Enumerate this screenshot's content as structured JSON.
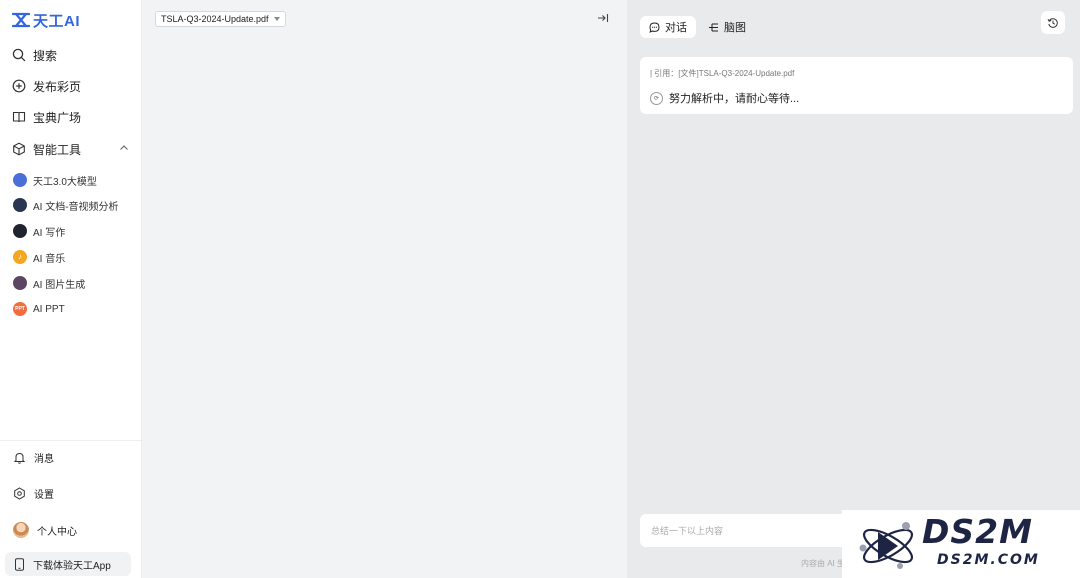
{
  "brand": {
    "name": "天工AI",
    "color": "#3465e0",
    "icon": "tiangong-logo-icon"
  },
  "sidebar": {
    "nav": [
      {
        "label": "搜索",
        "icon": "search-icon"
      },
      {
        "label": "发布彩页",
        "icon": "plus-circle-icon"
      },
      {
        "label": "宝典广场",
        "icon": "book-icon"
      },
      {
        "label": "智能工具",
        "icon": "cube-icon",
        "expanded": true
      }
    ],
    "tools": [
      {
        "label": "天工3.0大模型",
        "icon": "tiangong-model-icon",
        "color": "#4a6fd8"
      },
      {
        "label": "AI 文档-音视频分析",
        "icon": "doc-analysis-icon",
        "color": "#2a3552"
      },
      {
        "label": "AI 写作",
        "icon": "writing-icon",
        "color": "#1f2430"
      },
      {
        "label": "AI 音乐",
        "icon": "music-icon",
        "color": "#f5a623"
      },
      {
        "label": "AI 图片生成",
        "icon": "image-gen-icon",
        "color": "#5a4660"
      },
      {
        "label": "AI PPT",
        "icon": "ppt-icon",
        "color": "#f26d3d"
      }
    ],
    "bottom": [
      {
        "label": "消息",
        "icon": "bell-icon"
      },
      {
        "label": "设置",
        "icon": "settings-icon"
      },
      {
        "label": "个人中心",
        "icon": "avatar"
      }
    ],
    "download": {
      "label": "下载体验天工App",
      "icon": "phone-icon"
    }
  },
  "document": {
    "file_name": "TSLA-Q3-2024-Update.pdf"
  },
  "chat": {
    "tabs": [
      {
        "label": "对话",
        "icon": "chat-icon",
        "active": true
      },
      {
        "label": "脑图",
        "icon": "mindmap-icon",
        "active": false
      }
    ],
    "quote": "| 引用：[文件]TSLA-Q3-2024-Update.pdf",
    "status": "努力解析中，请耐心等待...",
    "input_placeholder": "总结一下以上内容",
    "footnote": "内容由 AI 生"
  },
  "watermark": {
    "title": "DS2M",
    "subtitle": "DS2M.COM"
  }
}
